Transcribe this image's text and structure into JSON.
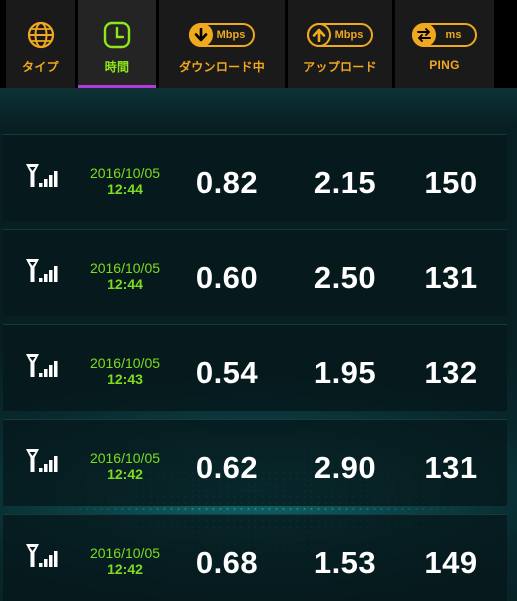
{
  "tabs": [
    {
      "label": "タイプ",
      "icon": "globe-icon",
      "unit": ""
    },
    {
      "label": "時間",
      "icon": "clock-icon",
      "unit": ""
    },
    {
      "label": "ダウンロード中",
      "icon": "download-arrow-icon",
      "unit": "Mbps"
    },
    {
      "label": "アップロード",
      "icon": "upload-arrow-icon",
      "unit": "Mbps"
    },
    {
      "label": "PING",
      "icon": "ping-arrows-icon",
      "unit": "ms"
    }
  ],
  "active_tab": "時間",
  "colors": {
    "accent_orange": "#f0a81e",
    "accent_green": "#8fe61a",
    "active_underline": "#b13bd6",
    "datetime_green": "#7ddc1f"
  },
  "results": [
    {
      "connection_icon": "cellular-signal-icon",
      "date": "2016/10/05",
      "time": "12:44",
      "download": "0.82",
      "upload": "2.15",
      "ping": "150"
    },
    {
      "connection_icon": "cellular-signal-icon",
      "date": "2016/10/05",
      "time": "12:44",
      "download": "0.60",
      "upload": "2.50",
      "ping": "131"
    },
    {
      "connection_icon": "cellular-signal-icon",
      "date": "2016/10/05",
      "time": "12:43",
      "download": "0.54",
      "upload": "1.95",
      "ping": "132"
    },
    {
      "connection_icon": "cellular-signal-icon",
      "date": "2016/10/05",
      "time": "12:42",
      "download": "0.62",
      "upload": "2.90",
      "ping": "131"
    },
    {
      "connection_icon": "cellular-signal-icon",
      "date": "2016/10/05",
      "time": "12:42",
      "download": "0.68",
      "upload": "1.53",
      "ping": "149"
    }
  ]
}
